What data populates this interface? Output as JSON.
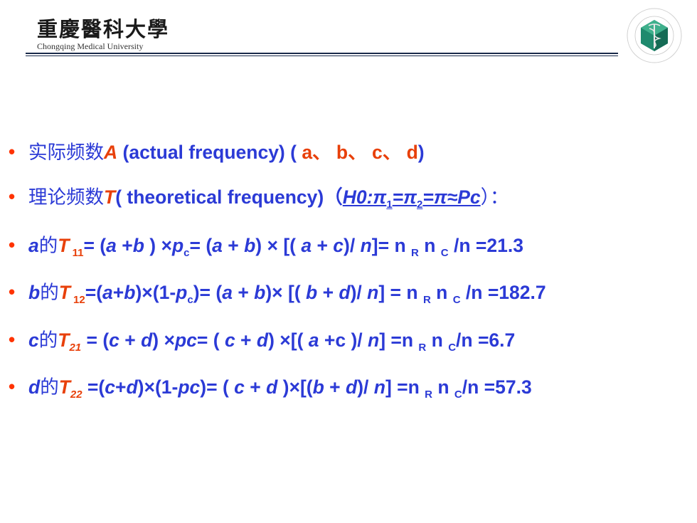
{
  "header": {
    "logo_cn": "重慶醫科大學",
    "logo_en": "Chongqing Medical University",
    "emblem_label": "Chongqing Medical University"
  },
  "bullets": [
    {
      "parts": [
        {
          "t": "实际频数",
          "c": "cn"
        },
        {
          "t": "A",
          "c": "red it"
        },
        {
          "t": "  (actual frequency) ( "
        },
        {
          "t": "a、 b、 c、 d",
          "c": "red"
        },
        {
          "t": ")"
        }
      ]
    },
    {
      "parts": [
        {
          "t": "理论频数",
          "c": "cn"
        },
        {
          "t": "T",
          "c": "red it"
        },
        {
          "t": "( theoretical frequency)（"
        },
        {
          "t": "H0:π",
          "c": "it u"
        },
        {
          "t": "1",
          "c": "sub u"
        },
        {
          "t": "=π",
          "c": "it u"
        },
        {
          "t": "2",
          "c": "sub u"
        },
        {
          "t": "=π≈Pc",
          "c": "it u"
        },
        {
          "t": "）：",
          "c": "cn"
        }
      ]
    },
    {
      "parts": [
        {
          "t": "a",
          "c": "it"
        },
        {
          "t": "的",
          "c": "cn"
        },
        {
          "t": "T",
          "c": "red it"
        },
        {
          "t": " 11",
          "c": "sub red"
        },
        {
          "t": "= ("
        },
        {
          "t": "a",
          "c": "it"
        },
        {
          "t": " +"
        },
        {
          "t": "b",
          "c": "it"
        },
        {
          "t": " ) ×"
        },
        {
          "t": "p",
          "c": "it"
        },
        {
          "t": "c",
          "c": "sub"
        },
        {
          "t": "=  ("
        },
        {
          "t": "a",
          "c": "it"
        },
        {
          "t": " + "
        },
        {
          "t": "b",
          "c": "it"
        },
        {
          "t": ") × [( "
        },
        {
          "t": "a",
          "c": "it"
        },
        {
          "t": " + "
        },
        {
          "t": "c",
          "c": "it"
        },
        {
          "t": ")/ "
        },
        {
          "t": "n",
          "c": "it"
        },
        {
          "t": "]= n "
        },
        {
          "t": "R",
          "c": "sub"
        },
        {
          "t": " n "
        },
        {
          "t": "C",
          "c": "sub"
        },
        {
          "t": " /n =21.3"
        }
      ]
    },
    {
      "parts": [
        {
          "t": "b",
          "c": "it"
        },
        {
          "t": "的",
          "c": "cn"
        },
        {
          "t": "T",
          "c": "red it"
        },
        {
          "t": " 12",
          "c": "sub red"
        },
        {
          "t": "=("
        },
        {
          "t": "a",
          "c": "it"
        },
        {
          "t": "+"
        },
        {
          "t": "b",
          "c": "it"
        },
        {
          "t": ")×(1-"
        },
        {
          "t": "p",
          "c": "it"
        },
        {
          "t": "c",
          "c": "sub"
        },
        {
          "t": ")= ("
        },
        {
          "t": "a",
          "c": "it"
        },
        {
          "t": " + "
        },
        {
          "t": "b",
          "c": "it"
        },
        {
          "t": ")× [( "
        },
        {
          "t": "b",
          "c": "it"
        },
        {
          "t": " + "
        },
        {
          "t": "d",
          "c": "it"
        },
        {
          "t": ")/ "
        },
        {
          "t": "n",
          "c": "it"
        },
        {
          "t": "] = n "
        },
        {
          "t": "R",
          "c": "sub"
        },
        {
          "t": " n "
        },
        {
          "t": "C",
          "c": "sub"
        },
        {
          "t": " /n =182.7"
        }
      ]
    },
    {
      "parts": [
        {
          "t": "c",
          "c": "it"
        },
        {
          "t": "的",
          "c": "cn"
        },
        {
          "t": "T",
          "c": "red it"
        },
        {
          "t": "21",
          "c": "sub red it"
        },
        {
          "t": " = ("
        },
        {
          "t": "c",
          "c": "it"
        },
        {
          "t": " + "
        },
        {
          "t": "d",
          "c": "it"
        },
        {
          "t": ") ×"
        },
        {
          "t": "pc",
          "c": "it"
        },
        {
          "t": "= ( "
        },
        {
          "t": "c",
          "c": "it"
        },
        {
          "t": " + "
        },
        {
          "t": "d",
          "c": "it"
        },
        {
          "t": ") ×[( "
        },
        {
          "t": "a",
          "c": "it"
        },
        {
          "t": " +c )/ "
        },
        {
          "t": "n",
          "c": "it"
        },
        {
          "t": "] =n "
        },
        {
          "t": "R",
          "c": "sub"
        },
        {
          "t": " n "
        },
        {
          "t": "C",
          "c": "sub"
        },
        {
          "t": "/n =6.7"
        }
      ]
    },
    {
      "parts": [
        {
          "t": "d",
          "c": "it"
        },
        {
          "t": "的",
          "c": "cn"
        },
        {
          "t": "T",
          "c": "red it"
        },
        {
          "t": "22",
          "c": "sub red it"
        },
        {
          "t": " =("
        },
        {
          "t": "c",
          "c": "it"
        },
        {
          "t": "+"
        },
        {
          "t": "d",
          "c": "it"
        },
        {
          "t": ")×(1-"
        },
        {
          "t": "pc",
          "c": "it"
        },
        {
          "t": ")=  ( "
        },
        {
          "t": "c",
          "c": "it"
        },
        {
          "t": " + "
        },
        {
          "t": "d",
          "c": "it"
        },
        {
          "t": " )×[("
        },
        {
          "t": "b",
          "c": "it"
        },
        {
          "t": " + "
        },
        {
          "t": "d",
          "c": "it"
        },
        {
          "t": ")/ "
        },
        {
          "t": "n",
          "c": "it"
        },
        {
          "t": "] =n "
        },
        {
          "t": "R",
          "c": "sub"
        },
        {
          "t": " n "
        },
        {
          "t": "C",
          "c": "sub"
        },
        {
          "t": "/n =57.3"
        }
      ]
    }
  ],
  "colors": {
    "text_blue": "#2b3ad6",
    "accent_red": "#e8400a",
    "bullet_red": "#ff3300",
    "rule": "#1a2a4a"
  }
}
